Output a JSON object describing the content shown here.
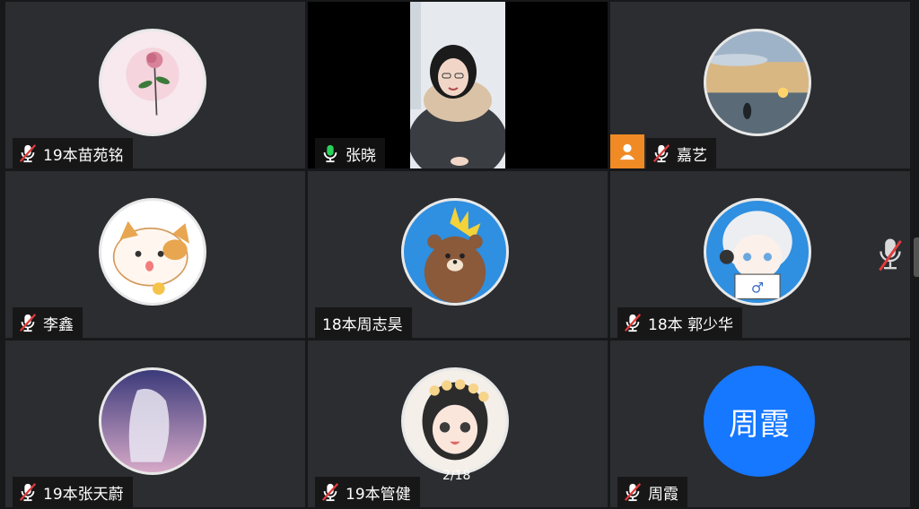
{
  "participants": [
    {
      "name": "19本苗苑铭",
      "muted": true
    },
    {
      "name": "张晓",
      "muted": false
    },
    {
      "name": "嘉艺",
      "muted": true
    },
    {
      "name": "李鑫",
      "muted": true
    },
    {
      "name": "18本周志昊",
      "muted": null
    },
    {
      "name": "18本 郭少华",
      "muted": true
    },
    {
      "name": "19本张天蔚",
      "muted": true
    },
    {
      "name": "19本管健",
      "muted": true
    },
    {
      "name": "周霞",
      "muted": true
    }
  ],
  "placeholder_avatar_text": "周霞",
  "page_indicator": "2/18",
  "colors": {
    "tile": "#2b2d30",
    "accent_blue": "#1677ff",
    "host_orange": "#f08a24",
    "mic_on": "#2bd15a",
    "mic_off": "#e03b3b"
  }
}
